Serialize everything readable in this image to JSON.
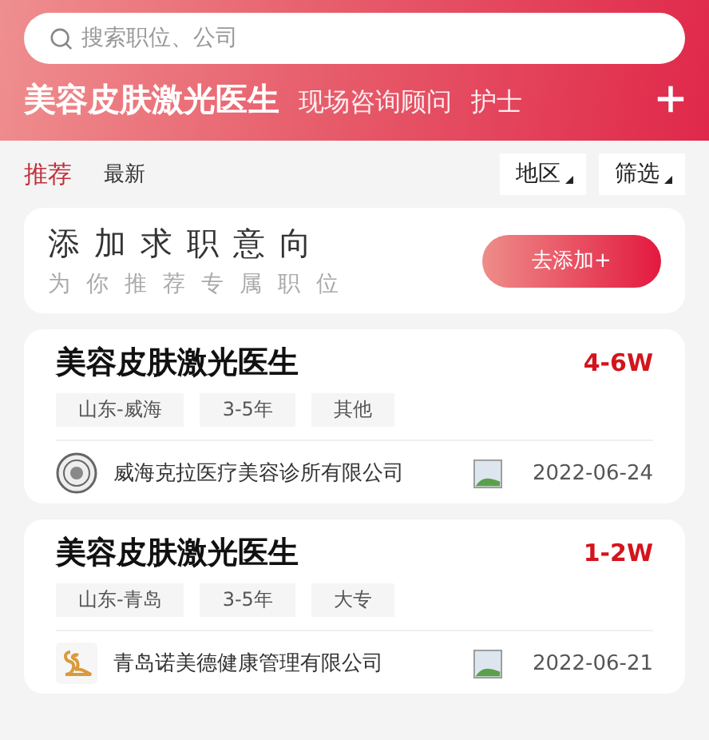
{
  "search": {
    "placeholder": "搜索职位、公司"
  },
  "categories": [
    {
      "label": "美容皮肤激光医生",
      "selected": true
    },
    {
      "label": "现场咨询顾问",
      "selected": false
    },
    {
      "label": "护士",
      "selected": false
    }
  ],
  "tabs": [
    {
      "label": "推荐",
      "selected": true
    },
    {
      "label": "最新",
      "selected": false
    }
  ],
  "filters": [
    "地区",
    "筛选"
  ],
  "promo": {
    "title": "添加求职意向",
    "subtitle": "为你推荐专属职位",
    "button": "去添加+"
  },
  "jobs": [
    {
      "title": "美容皮肤激光医生",
      "salary": "4-6W",
      "tags": [
        "山东-威海",
        "3-5年",
        "其他"
      ],
      "company": "威海克拉医疗美容诊所有限公司",
      "kind": "seal",
      "date": "2022-06-24"
    },
    {
      "title": "美容皮肤激光医生",
      "salary": "1-2W",
      "tags": [
        "山东-青岛",
        "3-5年",
        "大专"
      ],
      "company": "青岛诺美德健康管理有限公司",
      "kind": "swan",
      "date": "2022-06-21"
    }
  ]
}
